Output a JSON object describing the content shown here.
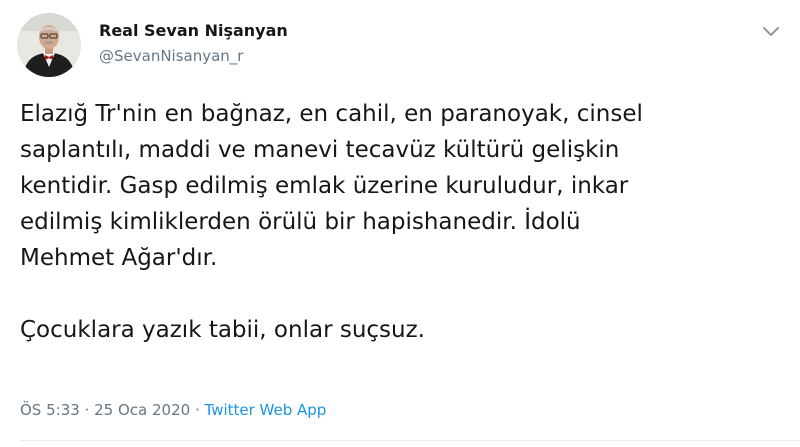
{
  "author": {
    "display_name": "Real Sevan Nişanyan",
    "handle": "@SevanNisanyan_r",
    "avatar_icon": "profile-photo"
  },
  "tweet": {
    "text": "Elazığ Tr'nin en bağnaz, en cahil, en paranoyak, cinsel\nsaplantılı, maddi ve manevi tecavüz kültürü gelişkin\nkentidir. Gasp edilmiş emlak üzerine kuruludur, inkar\nedilmiş kimliklerden örülü bir hapishanedir. İdolü\nMehmet Ağar'dır.\n\nÇocuklara yazık tabii, onlar suçsuz."
  },
  "meta": {
    "time": "ÖS 5:33",
    "separator": "·",
    "date": "25 Oca 2020",
    "source": "Twitter Web App"
  },
  "menu_icon": "chevron-down-icon",
  "colors": {
    "text": "#14171a",
    "secondary": "#657786",
    "link": "#1b95e0",
    "divider": "#e6ecf0"
  }
}
